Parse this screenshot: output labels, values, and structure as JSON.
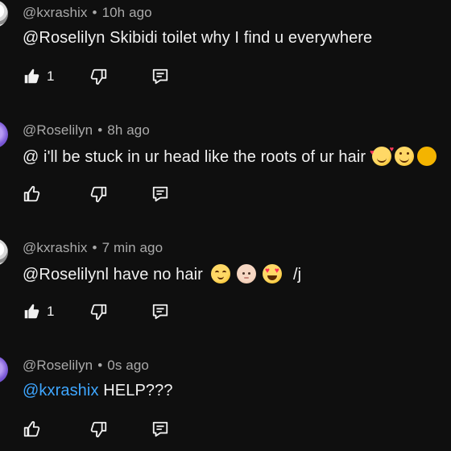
{
  "comments": [
    {
      "username": "@kxrashix",
      "dot": "•",
      "time": "10h ago",
      "text": "@Roselilyn Skibidi toilet why I find u everywhere",
      "likes": "1",
      "liked": true,
      "avatar": "kxrashix-avatar"
    },
    {
      "username": "@Roselilyn",
      "dot": "•",
      "time": "8h ago",
      "text": "@ i'll be stuck in ur head like the roots of ur hair",
      "emojis": [
        "smiling-face-with-hearts",
        "smiling-face"
      ],
      "likes": "",
      "liked": false,
      "avatar": "roselilyn-avatar"
    },
    {
      "username": "@kxrashix",
      "dot": "•",
      "time": "7 min ago",
      "text": "@Roselilynl have no hair",
      "emojis": [
        "relieved-face",
        "bald-person",
        "heart-eyes"
      ],
      "text_suffix": "/j",
      "likes": "1",
      "liked": true,
      "avatar": "kxrashix-avatar"
    },
    {
      "username": "@Roselilyn",
      "dot": "•",
      "time": "0s ago",
      "mention": "@kxrashix",
      "text": "HELP???",
      "likes": "",
      "liked": false,
      "avatar": "roselilyn-avatar"
    }
  ],
  "icons": {
    "like": "thumbs-up-icon",
    "dislike": "thumbs-down-icon",
    "reply": "reply-icon"
  },
  "colors": {
    "background": "#0f0f0f",
    "text": "#f1f1f1",
    "meta": "#aaaaaa",
    "mention": "#3ea6ff"
  }
}
